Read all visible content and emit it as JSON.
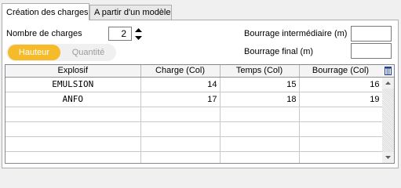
{
  "tabs": [
    {
      "label": "Création des charges",
      "active": true
    },
    {
      "label": "A partir d'un modèle",
      "active": false
    }
  ],
  "form": {
    "charges_label": "Nombre de charges",
    "charges_value": "2",
    "bourrage_intermediaire_label": "Bourrage intermédiaire (m)",
    "bourrage_intermediaire_value": "",
    "bourrage_final_label": "Bourrage final (m)",
    "bourrage_final_value": ""
  },
  "toggle": {
    "options": [
      "Hauteur",
      "Quantité"
    ],
    "selected": "Hauteur",
    "active_color": "#f6bb2a"
  },
  "grid": {
    "columns": [
      "Explosif",
      "Charge (Col)",
      "Temps (Col)",
      "Bourrage (Col)"
    ],
    "rows": [
      [
        "EMULSION",
        "14",
        "15",
        "16"
      ],
      [
        "ANFO",
        "17",
        "18",
        "19"
      ],
      [
        "",
        "",
        "",
        ""
      ],
      [
        "",
        "",
        "",
        ""
      ],
      [
        "",
        "",
        "",
        ""
      ],
      [
        "",
        "",
        "",
        ""
      ]
    ],
    "column_chooser_icon": "table-columns-icon"
  },
  "icons": {
    "spin_up": "chevron-up-icon",
    "spin_down": "chevron-down-icon",
    "scroll_up": "scroll-up-arrow-icon",
    "scroll_down": "scroll-down-arrow-icon"
  }
}
